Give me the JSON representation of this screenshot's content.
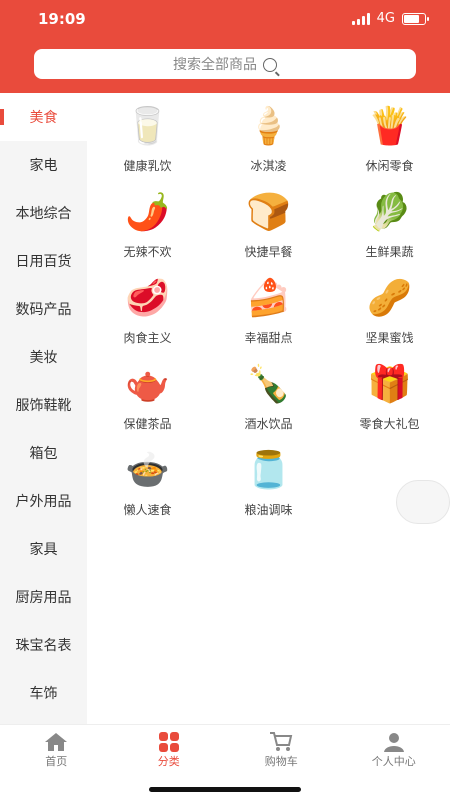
{
  "status": {
    "time": "19:09",
    "network": "4G"
  },
  "search": {
    "placeholder": "搜索全部商品"
  },
  "sidebar": {
    "items": [
      {
        "label": "美食",
        "active": true
      },
      {
        "label": "家电"
      },
      {
        "label": "本地综合"
      },
      {
        "label": "日用百货"
      },
      {
        "label": "数码产品"
      },
      {
        "label": "美妆"
      },
      {
        "label": "服饰鞋靴"
      },
      {
        "label": "箱包"
      },
      {
        "label": "户外用品"
      },
      {
        "label": "家具"
      },
      {
        "label": "厨房用品"
      },
      {
        "label": "珠宝名表"
      },
      {
        "label": "车饰"
      }
    ]
  },
  "categories": [
    {
      "label": "健康乳饮",
      "icon": "🥛"
    },
    {
      "label": "冰淇凌",
      "icon": "🍦"
    },
    {
      "label": "休闲零食",
      "icon": "🍟"
    },
    {
      "label": "无辣不欢",
      "icon": "🌶️"
    },
    {
      "label": "快捷早餐",
      "icon": "🍞"
    },
    {
      "label": "生鲜果蔬",
      "icon": "🥬"
    },
    {
      "label": "肉食主义",
      "icon": "🥩"
    },
    {
      "label": "幸福甜点",
      "icon": "🍰"
    },
    {
      "label": "坚果蜜饯",
      "icon": "🥜"
    },
    {
      "label": "保健茶品",
      "icon": "🫖"
    },
    {
      "label": "酒水饮品",
      "icon": "🍾"
    },
    {
      "label": "零食大礼包",
      "icon": "🎁"
    },
    {
      "label": "懒人速食",
      "icon": "🍲"
    },
    {
      "label": "粮油调味",
      "icon": "🫙"
    }
  ],
  "tabbar": {
    "home": "首页",
    "category": "分类",
    "cart": "购物车",
    "profile": "个人中心"
  },
  "colors": {
    "accent": "#e94b3c"
  }
}
